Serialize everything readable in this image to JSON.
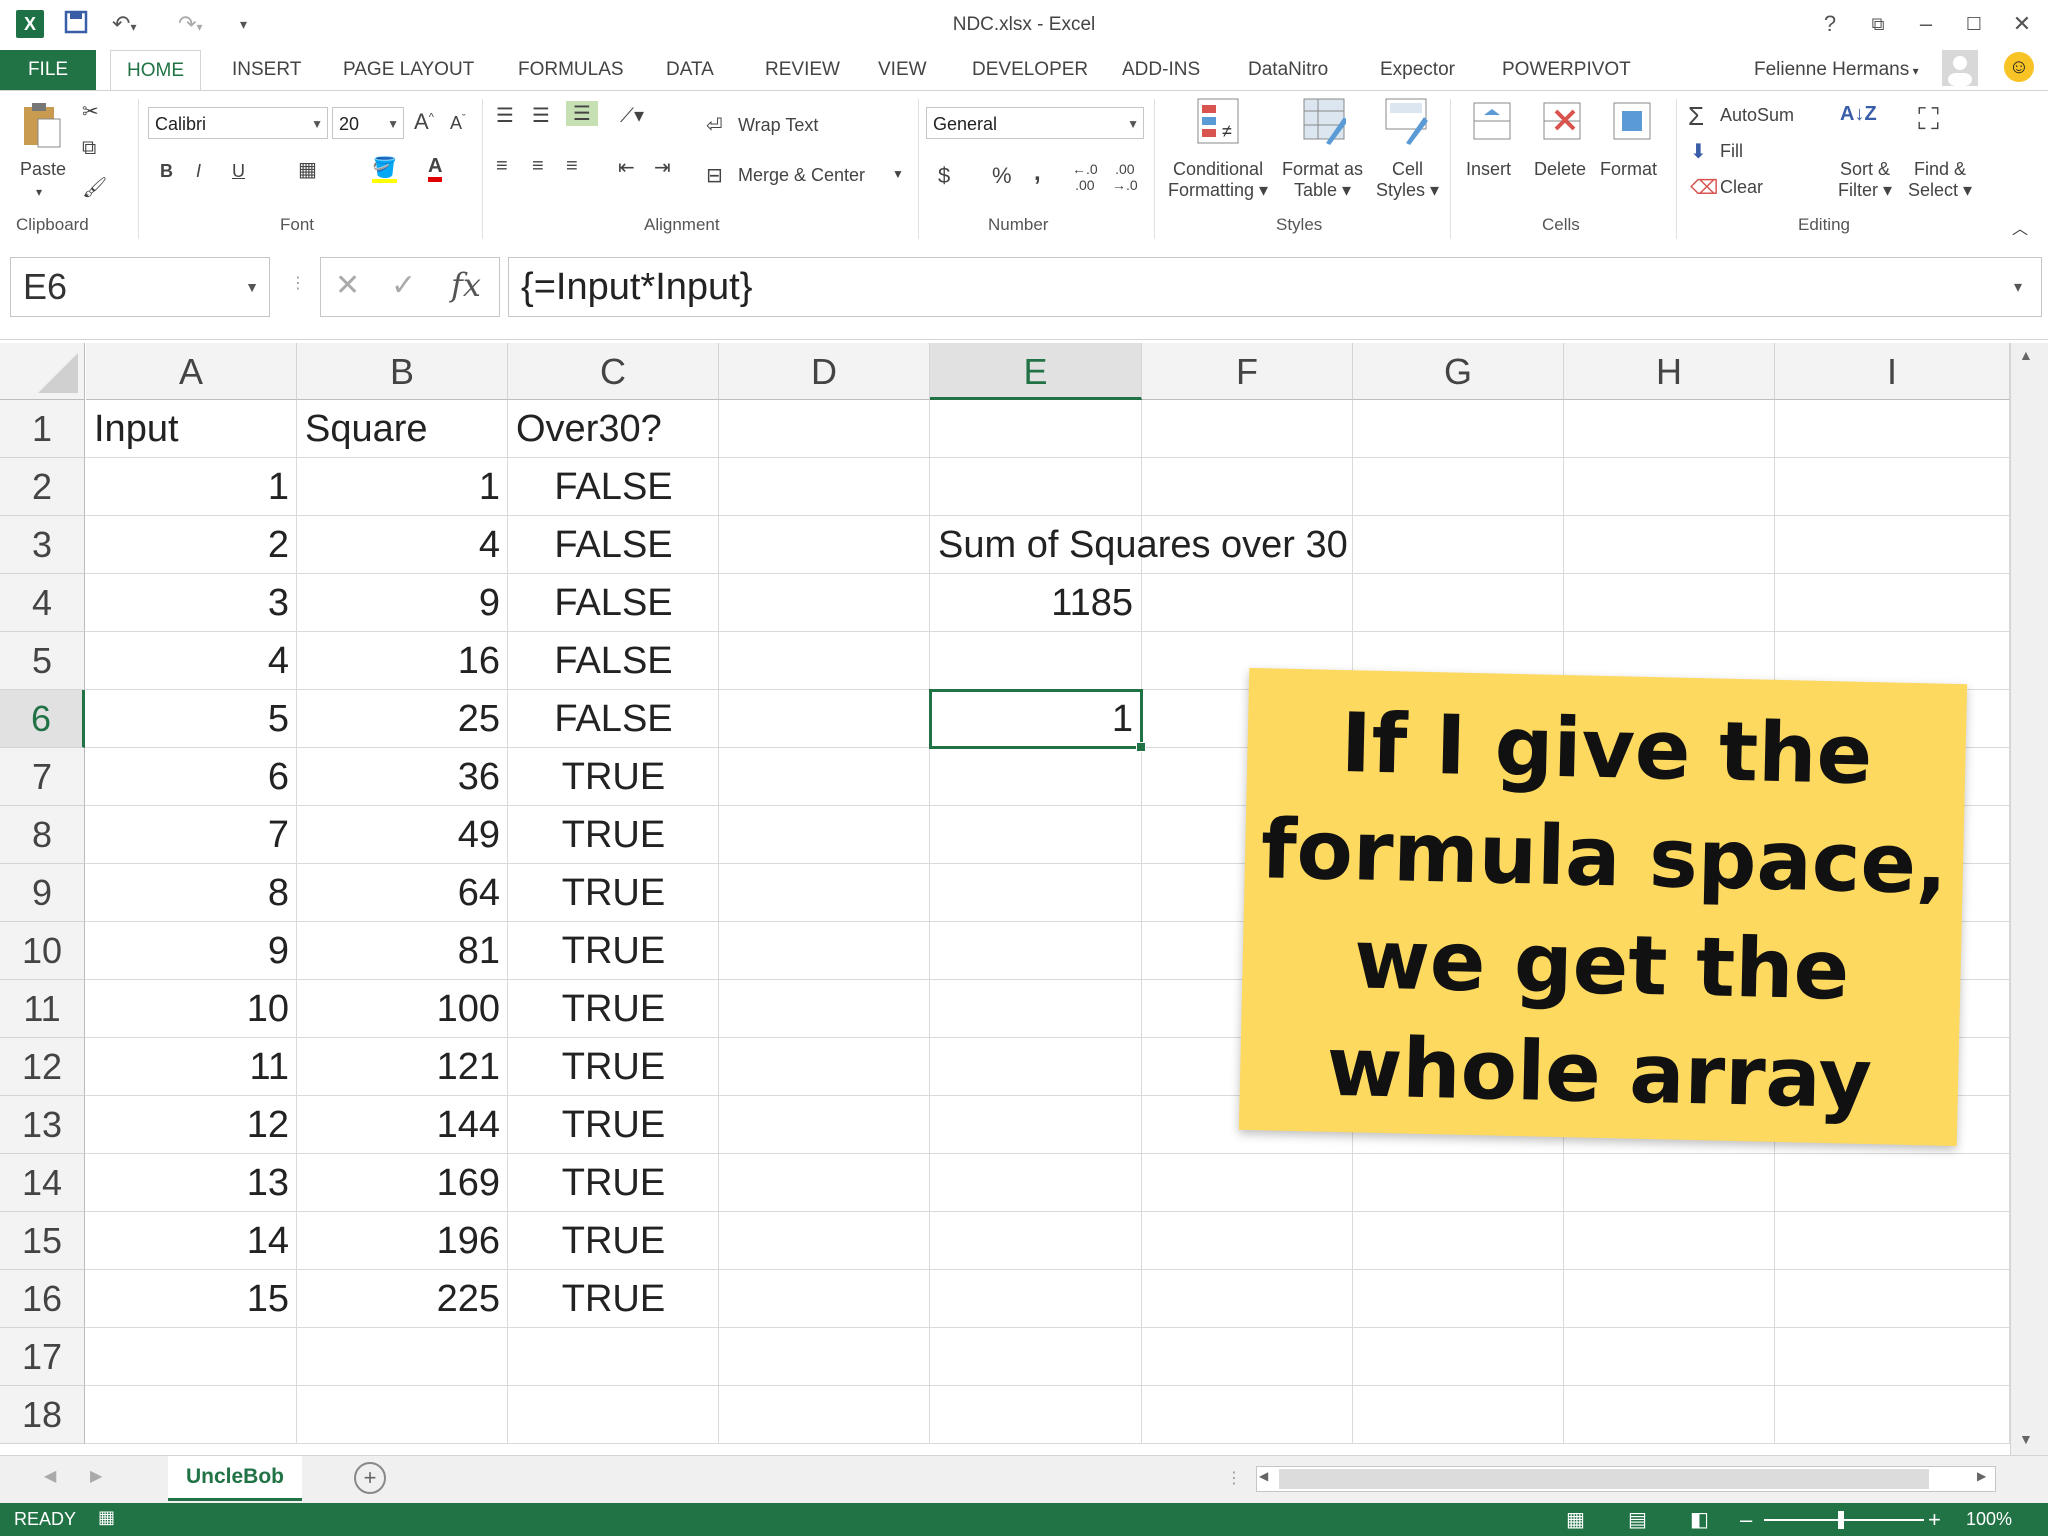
{
  "window": {
    "title": "NDC.xlsx - Excel",
    "app_icon": "X",
    "help": "?",
    "user": "Felienne Hermans"
  },
  "tabs": [
    "FILE",
    "HOME",
    "INSERT",
    "PAGE LAYOUT",
    "FORMULAS",
    "DATA",
    "REVIEW",
    "VIEW",
    "DEVELOPER",
    "ADD-INS",
    "DataNitro",
    "Expector",
    "POWERPIVOT"
  ],
  "ribbon": {
    "clipboard": {
      "label": "Clipboard",
      "paste": "Paste"
    },
    "font": {
      "label": "Font",
      "name": "Calibri",
      "size": "20",
      "bold": "B",
      "italic": "I",
      "underline": "U"
    },
    "alignment": {
      "label": "Alignment",
      "wrap": "Wrap Text",
      "merge": "Merge & Center"
    },
    "number": {
      "label": "Number",
      "format": "General",
      "currency": "$",
      "percent": "%",
      "comma": ","
    },
    "styles": {
      "label": "Styles",
      "conditional1": "Conditional",
      "conditional2": "Formatting",
      "format_table1": "Format as",
      "format_table2": "Table",
      "cell_styles1": "Cell",
      "cell_styles2": "Styles"
    },
    "cells": {
      "label": "Cells",
      "insert": "Insert",
      "delete": "Delete",
      "format": "Format"
    },
    "editing": {
      "label": "Editing",
      "autosum": "AutoSum",
      "fill": "Fill",
      "clear": "Clear",
      "sort1": "Sort &",
      "sort2": "Filter",
      "find1": "Find &",
      "find2": "Select"
    }
  },
  "formula_bar": {
    "name_box": "E6",
    "formula": "{=Input*Input}",
    "fx": "fx"
  },
  "columns": [
    "A",
    "B",
    "C",
    "D",
    "E",
    "F",
    "G",
    "H",
    "I"
  ],
  "selected_column": "E",
  "rows": [
    "1",
    "2",
    "3",
    "4",
    "5",
    "6",
    "7",
    "8",
    "9",
    "10",
    "11",
    "12",
    "13",
    "14",
    "15",
    "16",
    "17",
    "18"
  ],
  "selected_row": "6",
  "headers": {
    "a": "Input",
    "b": "Square",
    "c": "Over30?"
  },
  "data": [
    {
      "input": "1",
      "square": "1",
      "over30": "FALSE"
    },
    {
      "input": "2",
      "square": "4",
      "over30": "FALSE"
    },
    {
      "input": "3",
      "square": "9",
      "over30": "FALSE"
    },
    {
      "input": "4",
      "square": "16",
      "over30": "FALSE"
    },
    {
      "input": "5",
      "square": "25",
      "over30": "FALSE"
    },
    {
      "input": "6",
      "square": "36",
      "over30": "TRUE"
    },
    {
      "input": "7",
      "square": "49",
      "over30": "TRUE"
    },
    {
      "input": "8",
      "square": "64",
      "over30": "TRUE"
    },
    {
      "input": "9",
      "square": "81",
      "over30": "TRUE"
    },
    {
      "input": "10",
      "square": "100",
      "over30": "TRUE"
    },
    {
      "input": "11",
      "square": "121",
      "over30": "TRUE"
    },
    {
      "input": "12",
      "square": "144",
      "over30": "TRUE"
    },
    {
      "input": "13",
      "square": "169",
      "over30": "TRUE"
    },
    {
      "input": "14",
      "square": "196",
      "over30": "TRUE"
    },
    {
      "input": "15",
      "square": "225",
      "over30": "TRUE"
    }
  ],
  "e_cells": {
    "e3": "Sum of Squares over 30",
    "e4": "1185",
    "e6": "1"
  },
  "note": {
    "text_lines": [
      "If I give the",
      "formula space,",
      "we get the",
      "whole array"
    ],
    "color": "#fdd960"
  },
  "sheet": {
    "name": "UncleBob"
  },
  "status": {
    "mode": "READY",
    "zoom": "100%"
  },
  "colors": {
    "accent": "#217346",
    "note": "#fdd960"
  }
}
